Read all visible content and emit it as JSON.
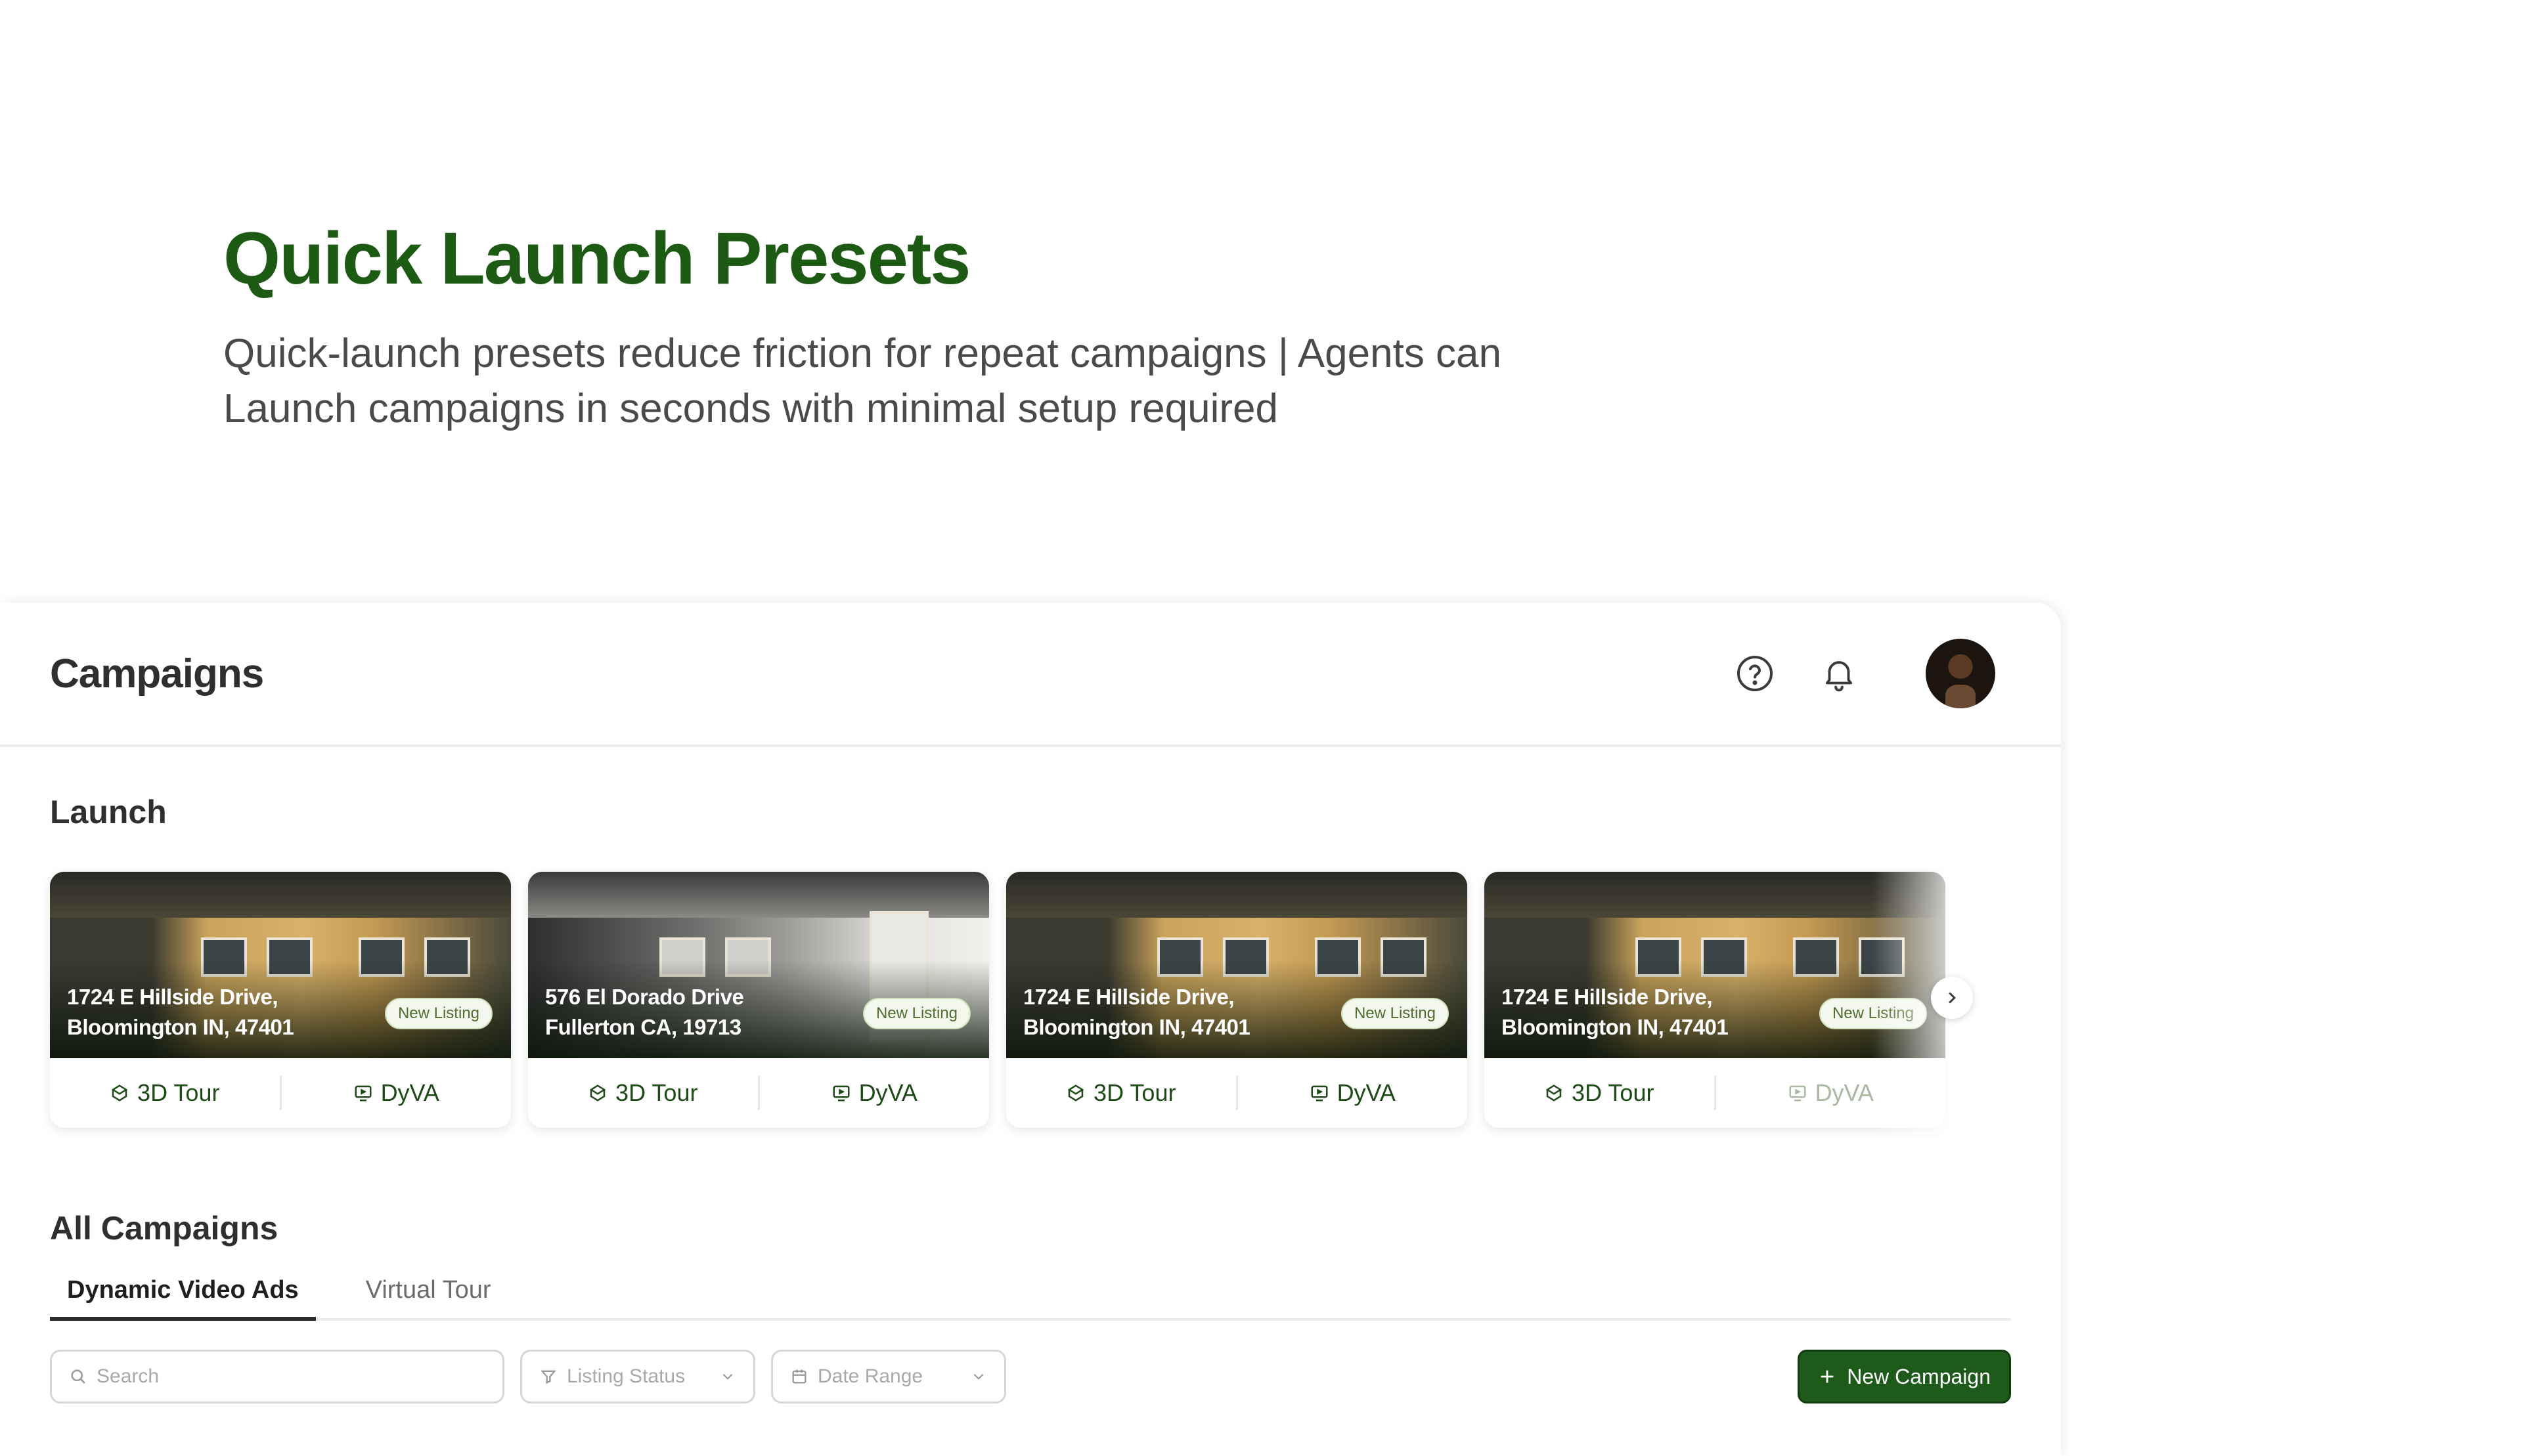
{
  "hero": {
    "title": "Quick Launch Presets",
    "subtitle": "Quick-launch presets reduce friction for repeat campaigns | Agents can Launch campaigns in seconds with minimal setup required"
  },
  "header": {
    "title": "Campaigns",
    "icons": [
      "help-circle-icon",
      "bell-icon",
      "avatar"
    ]
  },
  "launch": {
    "title": "Launch",
    "cards": [
      {
        "address_line1": "1724 E Hillside Drive,",
        "address_line2": "Bloomington IN, 47401",
        "badge": "New Listing",
        "action1": "3D Tour",
        "action2": "DyVA"
      },
      {
        "address_line1": "576 El Dorado Drive",
        "address_line2": "Fullerton CA, 19713",
        "badge": "New Listing",
        "action1": "3D Tour",
        "action2": "DyVA"
      },
      {
        "address_line1": "1724 E Hillside Drive,",
        "address_line2": "Bloomington IN, 47401",
        "badge": "New Listing",
        "action1": "3D Tour",
        "action2": "DyVA"
      },
      {
        "address_line1": "1724 E Hillside Drive,",
        "address_line2": "Bloomington IN, 47401",
        "badge": "New Listing",
        "action1": "3D Tour",
        "action2": "DyVA"
      }
    ]
  },
  "all_campaigns": {
    "title": "All Campaigns",
    "tabs": [
      {
        "label": "Dynamic Video Ads",
        "active": true
      },
      {
        "label": "Virtual Tour",
        "active": false
      }
    ]
  },
  "filters": {
    "search_placeholder": "Search",
    "listing_status": "Listing Status",
    "date_range": "Date Range",
    "new_campaign": "New Campaign"
  },
  "colors": {
    "brand_green": "#1d5a14",
    "button_green": "#1e5b1a"
  }
}
